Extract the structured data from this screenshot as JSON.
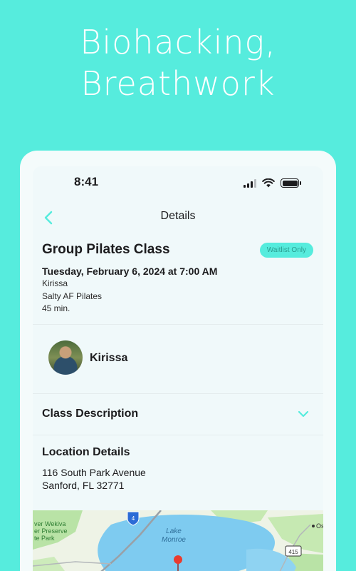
{
  "headline": {
    "line1": "Biohacking,",
    "line2": "Breathwork"
  },
  "status_bar": {
    "time": "8:41"
  },
  "nav": {
    "title": "Details"
  },
  "class": {
    "title": "Group Pilates Class",
    "badge": "Waitlist Only",
    "datetime": "Tuesday, February 6, 2024 at 7:00 AM",
    "instructor": "Kirissa",
    "studio": "Salty AF Pilates",
    "duration": "45 min."
  },
  "instructor_card": {
    "name": "Kirissa"
  },
  "description": {
    "title": "Class Description"
  },
  "location": {
    "title": "Location Details",
    "address_line1": "116 South Park Avenue",
    "address_line2": "Sanford, FL 32771"
  },
  "map": {
    "labels": {
      "preserve_line1": "ver Wekiva",
      "preserve_line2": "er Preserve",
      "preserve_line3": "te Park",
      "lake_line1": "Lake",
      "lake_line2": "Monroe",
      "highway": "4",
      "route": "415",
      "place": "Os"
    }
  },
  "colors": {
    "accent": "#56ecdd",
    "badge_text": "#2a9d90",
    "pin": "#ea3b2e"
  }
}
